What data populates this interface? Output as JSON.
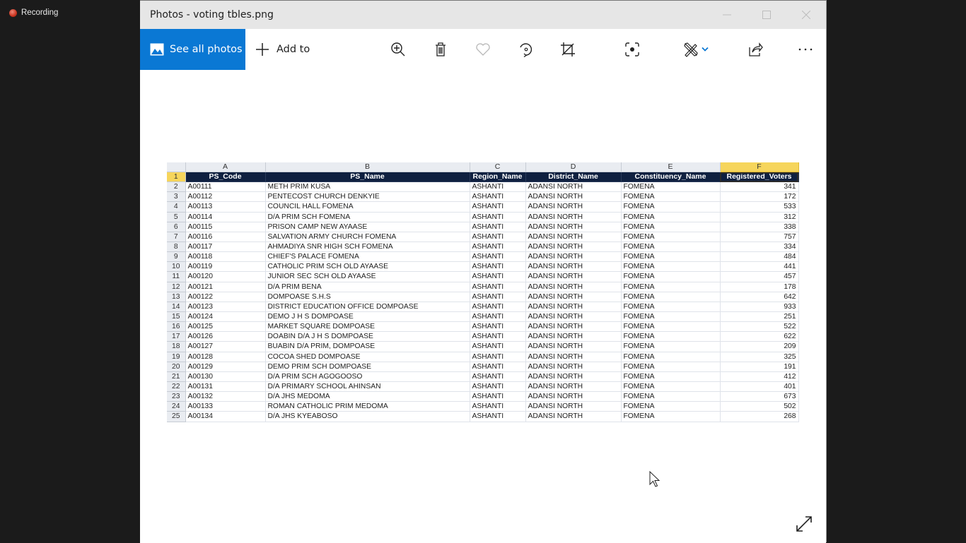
{
  "taskbar": {
    "recording_label": "Recording"
  },
  "window": {
    "title": "Photos - voting tbles.png",
    "controls": [
      "minimize",
      "maximize",
      "close"
    ]
  },
  "toolbar": {
    "see_all_label": "See all photos",
    "add_to_label": "Add to",
    "icons": [
      "zoom-in-icon",
      "delete-icon",
      "favorite-icon",
      "rotate-icon",
      "crop-icon",
      "visual-search-icon",
      "edit-create-icon",
      "share-icon",
      "more-icon"
    ],
    "accent": "#0a78d4"
  },
  "spreadsheet": {
    "column_letters": [
      "A",
      "B",
      "C",
      "D",
      "E",
      "F"
    ],
    "selected_column": "F",
    "headers": [
      "PS_Code",
      "PS_Name",
      "Region_Name",
      "District_Name",
      "Constituency_Name",
      "Registered_Voters"
    ],
    "header_row_number": "1",
    "rows": [
      {
        "n": "2",
        "code": "A00111",
        "name": "METH PRIM KUSA",
        "region": "ASHANTI",
        "district": "ADANSI NORTH",
        "constituency": "FOMENA",
        "voters": "341"
      },
      {
        "n": "3",
        "code": "A00112",
        "name": "PENTECOST CHURCH DENKYIE",
        "region": "ASHANTI",
        "district": "ADANSI NORTH",
        "constituency": "FOMENA",
        "voters": "172"
      },
      {
        "n": "4",
        "code": "A00113",
        "name": "COUNCIL HALL FOMENA",
        "region": "ASHANTI",
        "district": "ADANSI NORTH",
        "constituency": "FOMENA",
        "voters": "533"
      },
      {
        "n": "5",
        "code": "A00114",
        "name": "D/A PRIM SCH FOMENA",
        "region": "ASHANTI",
        "district": "ADANSI NORTH",
        "constituency": "FOMENA",
        "voters": "312"
      },
      {
        "n": "6",
        "code": "A00115",
        "name": "PRISON CAMP NEW AYAASE",
        "region": "ASHANTI",
        "district": "ADANSI NORTH",
        "constituency": "FOMENA",
        "voters": "338"
      },
      {
        "n": "7",
        "code": "A00116",
        "name": "SALVATION ARMY CHURCH FOMENA",
        "region": "ASHANTI",
        "district": "ADANSI NORTH",
        "constituency": "FOMENA",
        "voters": "757"
      },
      {
        "n": "8",
        "code": "A00117",
        "name": "AHMADIYA SNR HIGH SCH FOMENA",
        "region": "ASHANTI",
        "district": "ADANSI NORTH",
        "constituency": "FOMENA",
        "voters": "334"
      },
      {
        "n": "9",
        "code": "A00118",
        "name": "CHIEF'S PALACE FOMENA",
        "region": "ASHANTI",
        "district": "ADANSI NORTH",
        "constituency": "FOMENA",
        "voters": "484"
      },
      {
        "n": "10",
        "code": "A00119",
        "name": "CATHOLIC PRIM SCH OLD AYAASE",
        "region": "ASHANTI",
        "district": "ADANSI NORTH",
        "constituency": "FOMENA",
        "voters": "441"
      },
      {
        "n": "11",
        "code": "A00120",
        "name": "JUNIOR SEC SCH OLD AYAASE",
        "region": "ASHANTI",
        "district": "ADANSI NORTH",
        "constituency": "FOMENA",
        "voters": "457"
      },
      {
        "n": "12",
        "code": "A00121",
        "name": "D/A PRIM BENA",
        "region": "ASHANTI",
        "district": "ADANSI NORTH",
        "constituency": "FOMENA",
        "voters": "178"
      },
      {
        "n": "13",
        "code": "A00122",
        "name": "DOMPOASE S.H.S",
        "region": "ASHANTI",
        "district": "ADANSI NORTH",
        "constituency": "FOMENA",
        "voters": "642"
      },
      {
        "n": "14",
        "code": "A00123",
        "name": "DISTRICT EDUCATION OFFICE DOMPOASE",
        "region": "ASHANTI",
        "district": "ADANSI NORTH",
        "constituency": "FOMENA",
        "voters": "933"
      },
      {
        "n": "15",
        "code": "A00124",
        "name": "DEMO J H S DOMPOASE",
        "region": "ASHANTI",
        "district": "ADANSI NORTH",
        "constituency": "FOMENA",
        "voters": "251"
      },
      {
        "n": "16",
        "code": "A00125",
        "name": "MARKET SQUARE DOMPOASE",
        "region": "ASHANTI",
        "district": "ADANSI NORTH",
        "constituency": "FOMENA",
        "voters": "522"
      },
      {
        "n": "17",
        "code": "A00126",
        "name": "DOABIN D/A J H S DOMPOASE",
        "region": "ASHANTI",
        "district": "ADANSI NORTH",
        "constituency": "FOMENA",
        "voters": "622"
      },
      {
        "n": "18",
        "code": "A00127",
        "name": "BUABIN D/A PRIM, DOMPOASE",
        "region": "ASHANTI",
        "district": "ADANSI NORTH",
        "constituency": "FOMENA",
        "voters": "209"
      },
      {
        "n": "19",
        "code": "A00128",
        "name": "COCOA SHED DOMPOASE",
        "region": "ASHANTI",
        "district": "ADANSI NORTH",
        "constituency": "FOMENA",
        "voters": "325"
      },
      {
        "n": "20",
        "code": "A00129",
        "name": "DEMO PRIM SCH DOMPOASE",
        "region": "ASHANTI",
        "district": "ADANSI NORTH",
        "constituency": "FOMENA",
        "voters": "191"
      },
      {
        "n": "21",
        "code": "A00130",
        "name": "D/A PRIM SCH AGOGOOSO",
        "region": "ASHANTI",
        "district": "ADANSI NORTH",
        "constituency": "FOMENA",
        "voters": "412"
      },
      {
        "n": "22",
        "code": "A00131",
        "name": "D/A PRIMARY SCHOOL AHINSAN",
        "region": "ASHANTI",
        "district": "ADANSI NORTH",
        "constituency": "FOMENA",
        "voters": "401"
      },
      {
        "n": "23",
        "code": "A00132",
        "name": "D/A JHS MEDOMA",
        "region": "ASHANTI",
        "district": "ADANSI NORTH",
        "constituency": "FOMENA",
        "voters": "673"
      },
      {
        "n": "24",
        "code": "A00133",
        "name": "ROMAN CATHOLIC PRIM MEDOMA",
        "region": "ASHANTI",
        "district": "ADANSI NORTH",
        "constituency": "FOMENA",
        "voters": "502"
      },
      {
        "n": "25",
        "code": "A00134",
        "name": "D/A JHS KYEABOSO",
        "region": "ASHANTI",
        "district": "ADANSI NORTH",
        "constituency": "FOMENA",
        "voters": "268"
      }
    ]
  }
}
